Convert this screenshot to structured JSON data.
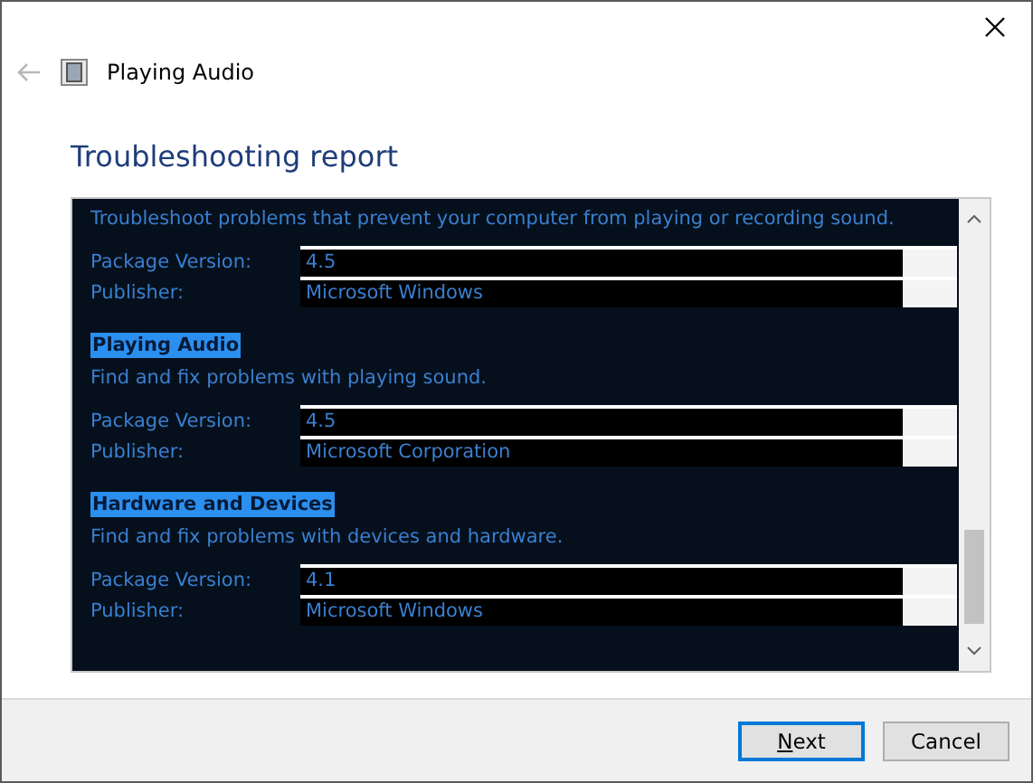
{
  "window": {
    "title": "Playing Audio"
  },
  "heading": "Troubleshooting report",
  "report": {
    "sections": [
      {
        "description": "Troubleshoot problems that prevent your computer from playing or recording sound.",
        "fields": [
          {
            "label": "Package Version:",
            "value": "4.5"
          },
          {
            "label": "Publisher:",
            "value": "Microsoft Windows"
          }
        ]
      },
      {
        "title": "Playing Audio",
        "description": "Find and fix problems with playing sound.",
        "fields": [
          {
            "label": "Package Version:",
            "value": "4.5"
          },
          {
            "label": "Publisher:",
            "value": "Microsoft Corporation"
          }
        ]
      },
      {
        "title": "Hardware and Devices",
        "description": "Find and fix problems with devices and hardware.",
        "fields": [
          {
            "label": "Package Version:",
            "value": "4.1"
          },
          {
            "label": "Publisher:",
            "value": "Microsoft Windows"
          }
        ]
      }
    ]
  },
  "buttons": [
    {
      "label": "Next",
      "default": true
    },
    {
      "label": "Cancel",
      "default": false
    }
  ]
}
